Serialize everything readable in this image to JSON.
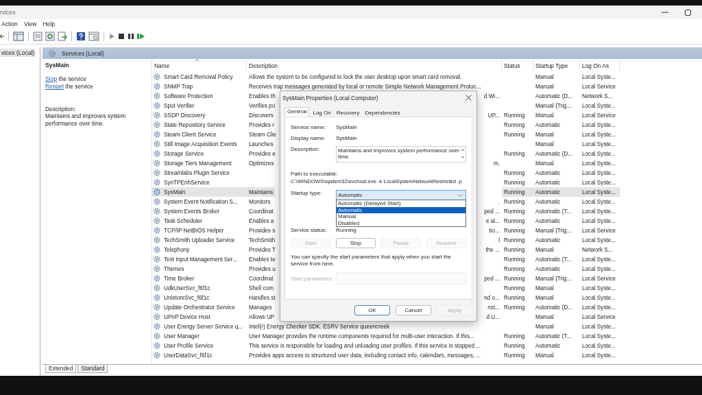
{
  "window": {
    "title": "rvices"
  },
  "menu": [
    "Action",
    "View",
    "Help"
  ],
  "tree": {
    "items": [
      {
        "label": "vices (Local)",
        "selected": true
      }
    ]
  },
  "pane": {
    "title": "Services (Local)"
  },
  "details": {
    "name": "SysMain",
    "actions": [
      {
        "link": "Stop",
        "text": "the service"
      },
      {
        "link": "Restart",
        "text": "the service"
      }
    ],
    "description_label": "Description:",
    "description": "Maintains and improves system performance over time."
  },
  "table": {
    "columns": [
      "Name",
      "Description",
      "Status",
      "Startup Type",
      "Log On As"
    ],
    "rows": [
      {
        "name": "Smart Card Removal Policy",
        "description": "Allows the system to be configured to lock the user desktop upon smart card removal.",
        "startup": "Manual",
        "logon": "Local Syste...",
        "selected": false
      },
      {
        "name": "SNMP Trap",
        "description": "Receives trap messages generated by local or remote Simple Network Management Protoc...",
        "startup": "Manual",
        "logon": "Local Service",
        "selected": false
      },
      {
        "name": "Software Protection",
        "description": "Enables th",
        "description_end": "d Wi...",
        "startup": "Automatic (D...",
        "logon": "Network S...",
        "selected": false
      },
      {
        "name": "Spot Verifier",
        "description": "Verifies po",
        "startup": "Manual (Trig...",
        "logon": "Local Syste...",
        "selected": false
      },
      {
        "name": "SSDP Discovery",
        "description": "Discovers",
        "description_end": "UP...",
        "status": "Running",
        "startup": "Manual",
        "logon": "Local Service",
        "selected": false
      },
      {
        "name": "State Repository Service",
        "description": "Provides r",
        "status": "Running",
        "startup": "Automatic",
        "logon": "Local Syste...",
        "selected": false
      },
      {
        "name": "Steam Client Service",
        "description": "Steam Clie",
        "status": "Running",
        "startup": "Manual",
        "logon": "Local Syste...",
        "selected": false
      },
      {
        "name": "Still Image Acquisition Events",
        "description": "Launches",
        "startup": "Manual",
        "logon": "Local Syste...",
        "selected": false
      },
      {
        "name": "Storage Service",
        "description": "Provides e",
        "status": "Running",
        "startup": "Automatic (D...",
        "logon": "Local Syste...",
        "selected": false
      },
      {
        "name": "Storage Tiers Management",
        "description": "Optimizes",
        "description_end": "m.",
        "startup": "Manual",
        "logon": "Local Syste...",
        "selected": false
      },
      {
        "name": "Streamlabs Plugin Service",
        "status": "Running",
        "startup": "Automatic",
        "logon": "Local Syste...",
        "selected": false
      },
      {
        "name": "SynTPEnhService",
        "status": "Running",
        "startup": "Automatic",
        "logon": "Local Syste...",
        "selected": false
      },
      {
        "name": "SysMain",
        "description": "Maintains",
        "status": "Running",
        "startup": "Automatic",
        "logon": "Local Syste...",
        "selected": true
      },
      {
        "name": "System Event Notification S...",
        "description": "Monitors",
        "description_end": ".",
        "status": "Running",
        "startup": "Automatic",
        "logon": "Local Syste...",
        "selected": false
      },
      {
        "name": "System Events Broker",
        "description": "Coordinat",
        "description_end": "ped ...",
        "status": "Running",
        "startup": "Automatic (T...",
        "logon": "Local Syste...",
        "selected": false
      },
      {
        "name": "Task Scheduler",
        "description": "Enables a",
        "description_end": "e al...",
        "status": "Running",
        "startup": "Automatic",
        "logon": "Local Syste...",
        "selected": false
      },
      {
        "name": "TCP/IP NetBIOS Helper",
        "description": "Provides s",
        "description_end": "tio...",
        "status": "Running",
        "startup": "Manual (Trig...",
        "logon": "Local Service",
        "selected": false
      },
      {
        "name": "TechSmith Uploader Service",
        "description": "TechSmith",
        "description_end": "l",
        "status": "Running",
        "startup": "Automatic",
        "logon": "Local Syste...",
        "selected": false
      },
      {
        "name": "Telephony",
        "description": "Provides T",
        "description_end": "the ...",
        "status": "Running",
        "startup": "Manual",
        "logon": "Network S...",
        "selected": false
      },
      {
        "name": "Text Input Management Ser...",
        "description": "Enables te",
        "status": "Running",
        "startup": "Automatic (T...",
        "logon": "Local Syste...",
        "selected": false
      },
      {
        "name": "Themes",
        "description": "Provides u",
        "status": "Running",
        "startup": "Automatic",
        "logon": "Local Syste...",
        "selected": false
      },
      {
        "name": "Time Broker",
        "description": "Coordinat",
        "description_end": "ped ...",
        "status": "Running",
        "startup": "Manual (Trig...",
        "logon": "Local Service",
        "selected": false
      },
      {
        "name": "UdkUserSvc_f6f1c",
        "description": "Shell com",
        "status": "Running",
        "startup": "Manual",
        "logon": "Local Syste...",
        "selected": false
      },
      {
        "name": "UnistoreSvc_f6f1c",
        "description": "Handles st",
        "description_end": "nd o...",
        "status": "Running",
        "startup": "Manual",
        "logon": "Local Syste...",
        "selected": false
      },
      {
        "name": "Update Orchestrator Service",
        "description": "Manages",
        "description_end": "nst...",
        "status": "Running",
        "startup": "Automatic (D...",
        "logon": "Local Syste...",
        "selected": false
      },
      {
        "name": "UPnP Device Host",
        "description": "Allows UP",
        "description_end": "d U...",
        "startup": "Manual",
        "logon": "Local Service",
        "selected": false
      },
      {
        "name": "User Energy Server Service q...",
        "description": "Intel(r) Energy Checker SDK. ESRV Service queencreek",
        "startup": "Manual",
        "logon": "Local Syste...",
        "selected": false
      },
      {
        "name": "User Manager",
        "description": "User Manager provides the runtime components required for multi-user interaction.  If this...",
        "status": "Running",
        "startup": "Automatic (T...",
        "logon": "Local Syste...",
        "selected": false
      },
      {
        "name": "User Profile Service",
        "description": "This service is responsible for loading and unloading user profiles. If this service is stopped ...",
        "status": "Running",
        "startup": "Automatic",
        "logon": "Local Syste...",
        "selected": false
      },
      {
        "name": "UserDataSvc_f6f1c",
        "description": "Provides apps access to structured user data, including contact info, calendars, messages, ...",
        "status": "Running",
        "startup": "Manual",
        "logon": "Local Syste...",
        "selected": false
      }
    ]
  },
  "view_tabs": [
    {
      "label": "Extended",
      "selected": true
    },
    {
      "label": "Standard",
      "selected": false
    }
  ],
  "dialog": {
    "title": "SysMain Properties (Local Computer)",
    "tabs": [
      {
        "label": "General",
        "selected": true
      },
      {
        "label": "Log On",
        "selected": false
      },
      {
        "label": "Recovery",
        "selected": false
      },
      {
        "label": "Dependencies",
        "selected": false
      }
    ],
    "fields": [
      {
        "label": "Service name:",
        "value": "SysMain"
      },
      {
        "label": "Display name:",
        "value": "SysMain"
      }
    ],
    "description_label": "Description:",
    "description": "Maintains and improves system performance over time.",
    "path_label": "Path to executable:",
    "path": "C:\\WINDOWS\\system32\\svchost.exe -k LocalSystemNetworkRestricted -p",
    "startup_label": "Startup type:",
    "startup_value": "Automatic",
    "options": [
      {
        "label": "Automatic (Delayed Start)",
        "selected": false
      },
      {
        "label": "Automatic",
        "selected": true
      },
      {
        "label": "Manual",
        "selected": false
      },
      {
        "label": "Disabled",
        "selected": false
      }
    ],
    "status_label": "Service status:",
    "status_value": "Running",
    "buttons": [
      {
        "label": "Start",
        "disabled": true
      },
      {
        "label": "Stop",
        "disabled": false
      },
      {
        "label": "Pause",
        "disabled": true
      },
      {
        "label": "Resume",
        "disabled": true
      }
    ],
    "note": "You can specify the start parameters that apply when you start the service from here.",
    "start_parameters": {
      "label": "Start parameters:",
      "disabled": true
    },
    "footer_buttons": [
      {
        "label": "OK",
        "disabled": false
      },
      {
        "label": "Cancel",
        "disabled": false
      },
      {
        "label": "Apply",
        "disabled": true
      }
    ]
  }
}
